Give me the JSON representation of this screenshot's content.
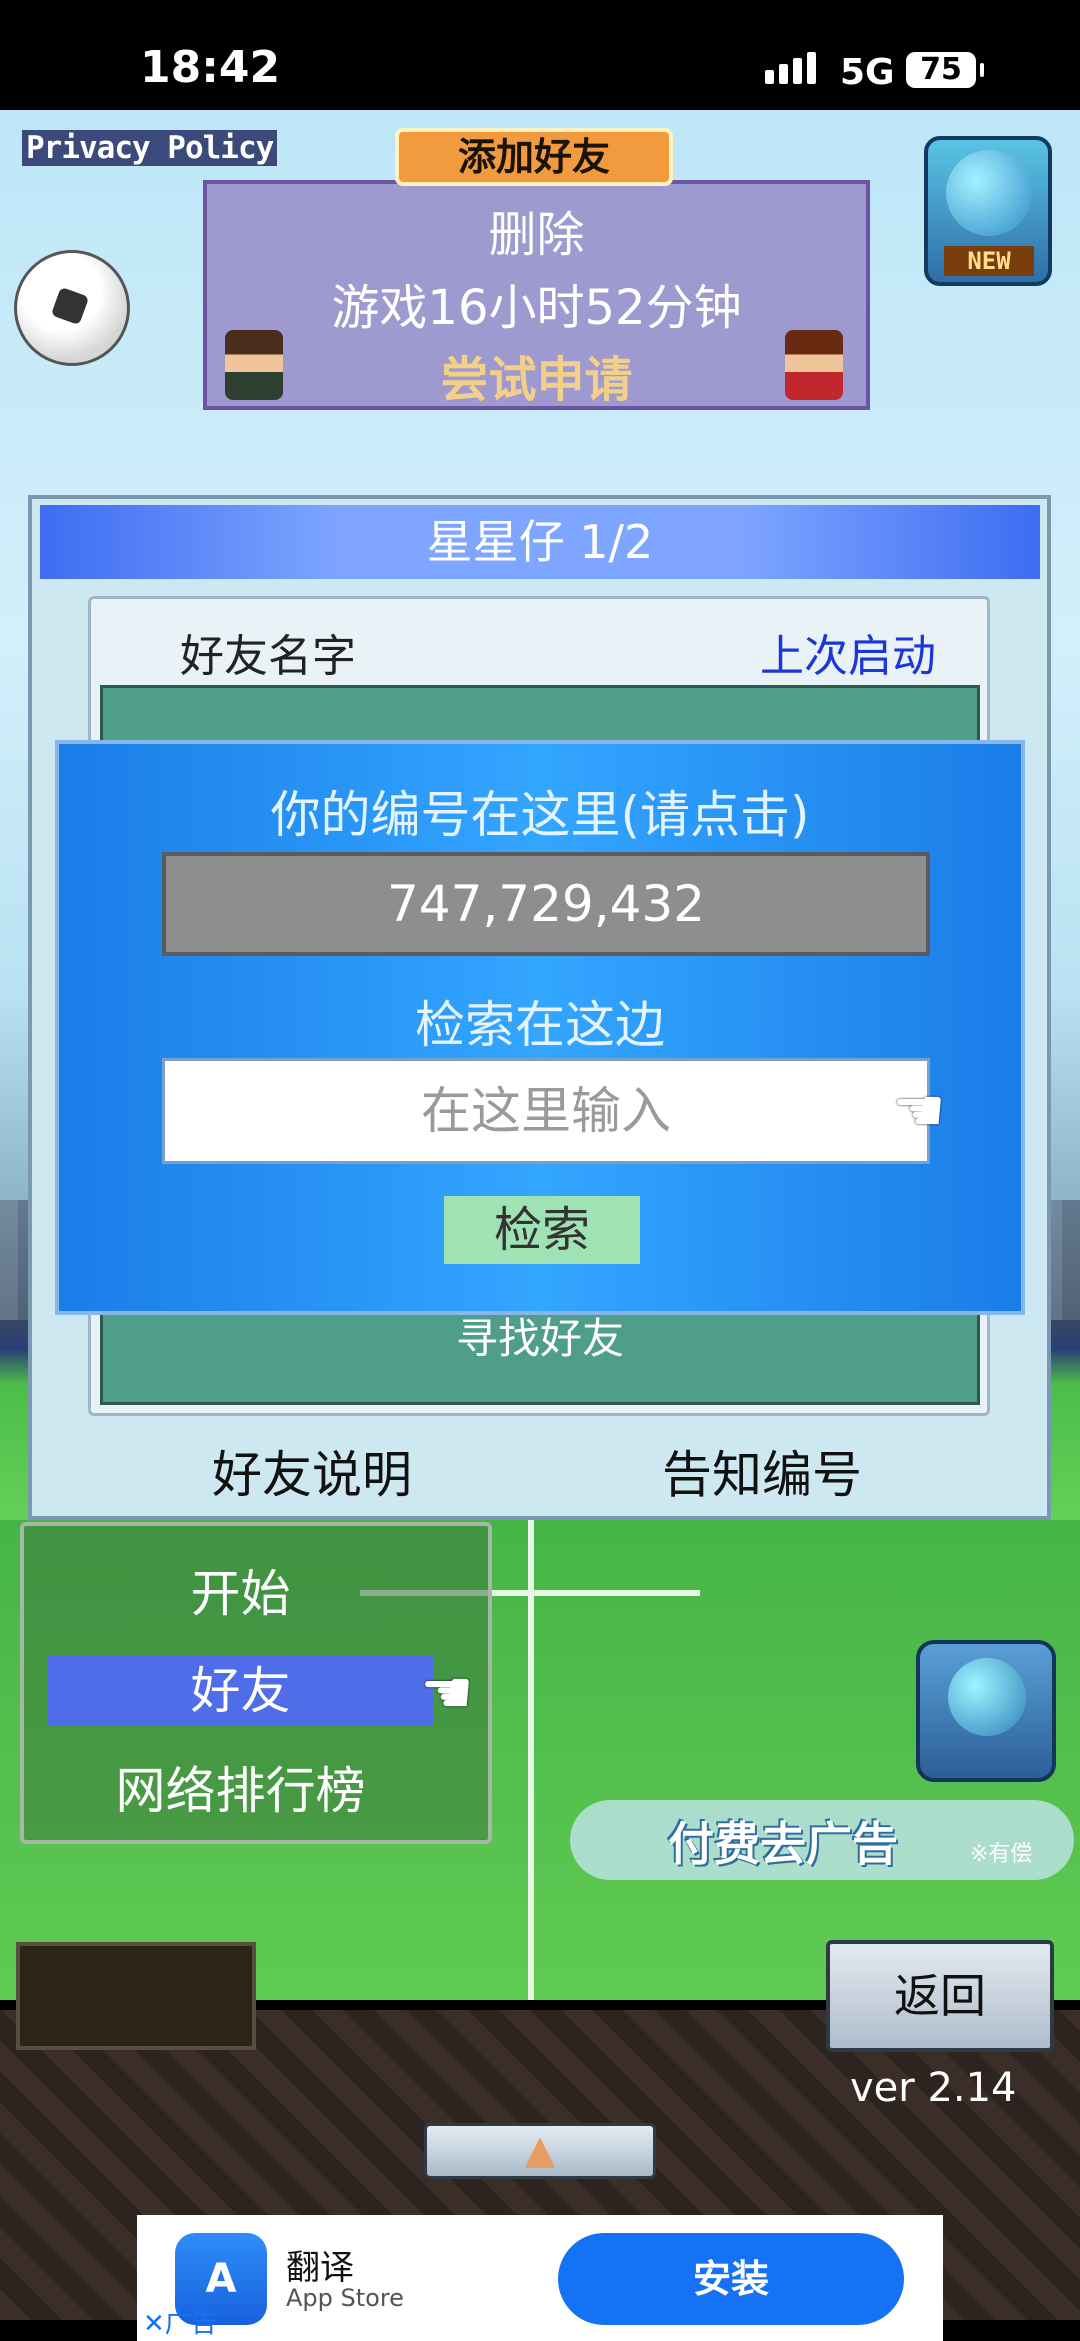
{
  "status": {
    "time": "18:42",
    "network": "5G",
    "battery": "75"
  },
  "top": {
    "privacy_policy": "Privacy Policy",
    "new_badge": "NEW",
    "friend_card": {
      "tab_label": "添加好友",
      "delete": "删除",
      "play_time": "游戏16小时52分钟",
      "apply": "尝试申请"
    }
  },
  "panel": {
    "title": "星星仔 1/2",
    "col_name": "好友名字",
    "col_last_launch": "上次启动",
    "find_friend": "寻找好友",
    "explain_button": "好友说明",
    "notify_button": "告知编号"
  },
  "dialog": {
    "your_id_title": "你的编号在这里(请点击)",
    "your_id": "747,729,432",
    "search_title": "检索在这边",
    "search_placeholder": "在这里输入",
    "search_button": "检索"
  },
  "menu": {
    "items": [
      "开始",
      "好友",
      "网络排行榜"
    ],
    "selected": "好友"
  },
  "right": {
    "remove_ads": "付费去广告",
    "remove_ads_note": "※有偿",
    "back_button": "返回",
    "version": "ver 2.14"
  },
  "ad": {
    "app_name": "翻译",
    "store": "App Store",
    "install": "安装",
    "label": "广告"
  },
  "colors": {
    "dialog_blue": "#1f8cf0",
    "header_blue": "#3d6df2",
    "menu_selected": "#4f6de8",
    "install_blue": "#1572f4"
  }
}
